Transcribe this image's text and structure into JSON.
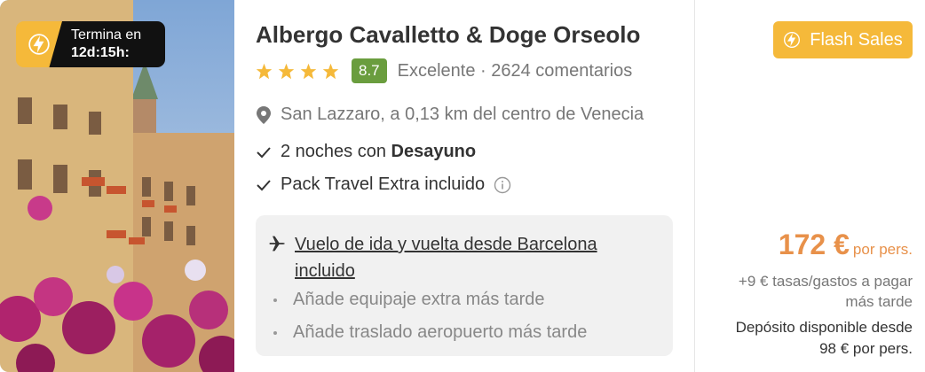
{
  "timer": {
    "line1": "Termina en",
    "line2": "12d:15h:"
  },
  "hotel": {
    "name": "Albergo Cavalletto & Doge Orseolo",
    "stars": 4,
    "score": "8.7",
    "rating_text": "Excelente · 2624 comentarios",
    "location": "San Lazzaro, a 0,13 km del centro de Venecia"
  },
  "features": {
    "nights_prefix": "2 noches con ",
    "nights_bold": "Desayuno",
    "pack": "Pack Travel Extra incluido"
  },
  "flight": {
    "main": "Vuelo de ida y vuelta desde Barcelona incluido",
    "extra1": "Añade equipaje extra más tarde",
    "extra2": "Añade traslado aeropuerto más tarde"
  },
  "pricing": {
    "badge": "Flash Sales",
    "price": "172 €",
    "per": "por pers.",
    "taxes_line1": "+9 € tasas/gastos a pagar",
    "taxes_line2": "más tarde",
    "deposit_line1": "Depósito disponible desde",
    "deposit_line2": "98 € por pers."
  },
  "colors": {
    "accent": "#f5b93a",
    "price": "#e8914a",
    "score_bg": "#6a9d3e"
  },
  "icons": [
    "lightning-icon",
    "star-icon",
    "map-pin-icon",
    "check-icon",
    "info-icon",
    "airplane-icon"
  ]
}
